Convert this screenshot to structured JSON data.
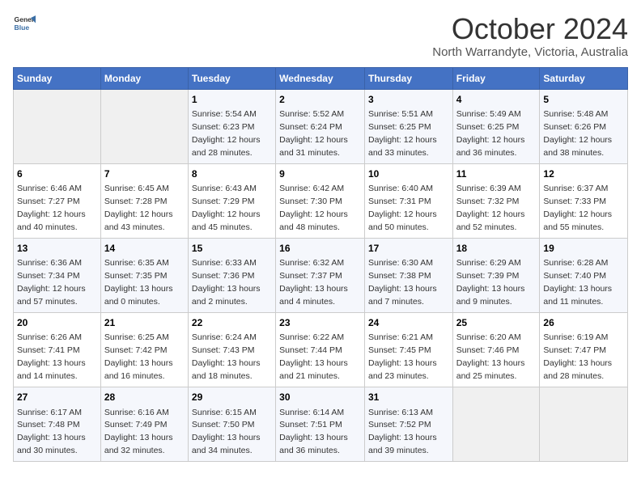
{
  "logo": {
    "general": "General",
    "blue": "Blue"
  },
  "title": "October 2024",
  "location": "North Warrandyte, Victoria, Australia",
  "headers": [
    "Sunday",
    "Monday",
    "Tuesday",
    "Wednesday",
    "Thursday",
    "Friday",
    "Saturday"
  ],
  "weeks": [
    [
      {
        "day": "",
        "info": ""
      },
      {
        "day": "",
        "info": ""
      },
      {
        "day": "1",
        "info": "Sunrise: 5:54 AM\nSunset: 6:23 PM\nDaylight: 12 hours and 28 minutes."
      },
      {
        "day": "2",
        "info": "Sunrise: 5:52 AM\nSunset: 6:24 PM\nDaylight: 12 hours and 31 minutes."
      },
      {
        "day": "3",
        "info": "Sunrise: 5:51 AM\nSunset: 6:25 PM\nDaylight: 12 hours and 33 minutes."
      },
      {
        "day": "4",
        "info": "Sunrise: 5:49 AM\nSunset: 6:25 PM\nDaylight: 12 hours and 36 minutes."
      },
      {
        "day": "5",
        "info": "Sunrise: 5:48 AM\nSunset: 6:26 PM\nDaylight: 12 hours and 38 minutes."
      }
    ],
    [
      {
        "day": "6",
        "info": "Sunrise: 6:46 AM\nSunset: 7:27 PM\nDaylight: 12 hours and 40 minutes."
      },
      {
        "day": "7",
        "info": "Sunrise: 6:45 AM\nSunset: 7:28 PM\nDaylight: 12 hours and 43 minutes."
      },
      {
        "day": "8",
        "info": "Sunrise: 6:43 AM\nSunset: 7:29 PM\nDaylight: 12 hours and 45 minutes."
      },
      {
        "day": "9",
        "info": "Sunrise: 6:42 AM\nSunset: 7:30 PM\nDaylight: 12 hours and 48 minutes."
      },
      {
        "day": "10",
        "info": "Sunrise: 6:40 AM\nSunset: 7:31 PM\nDaylight: 12 hours and 50 minutes."
      },
      {
        "day": "11",
        "info": "Sunrise: 6:39 AM\nSunset: 7:32 PM\nDaylight: 12 hours and 52 minutes."
      },
      {
        "day": "12",
        "info": "Sunrise: 6:37 AM\nSunset: 7:33 PM\nDaylight: 12 hours and 55 minutes."
      }
    ],
    [
      {
        "day": "13",
        "info": "Sunrise: 6:36 AM\nSunset: 7:34 PM\nDaylight: 12 hours and 57 minutes."
      },
      {
        "day": "14",
        "info": "Sunrise: 6:35 AM\nSunset: 7:35 PM\nDaylight: 13 hours and 0 minutes."
      },
      {
        "day": "15",
        "info": "Sunrise: 6:33 AM\nSunset: 7:36 PM\nDaylight: 13 hours and 2 minutes."
      },
      {
        "day": "16",
        "info": "Sunrise: 6:32 AM\nSunset: 7:37 PM\nDaylight: 13 hours and 4 minutes."
      },
      {
        "day": "17",
        "info": "Sunrise: 6:30 AM\nSunset: 7:38 PM\nDaylight: 13 hours and 7 minutes."
      },
      {
        "day": "18",
        "info": "Sunrise: 6:29 AM\nSunset: 7:39 PM\nDaylight: 13 hours and 9 minutes."
      },
      {
        "day": "19",
        "info": "Sunrise: 6:28 AM\nSunset: 7:40 PM\nDaylight: 13 hours and 11 minutes."
      }
    ],
    [
      {
        "day": "20",
        "info": "Sunrise: 6:26 AM\nSunset: 7:41 PM\nDaylight: 13 hours and 14 minutes."
      },
      {
        "day": "21",
        "info": "Sunrise: 6:25 AM\nSunset: 7:42 PM\nDaylight: 13 hours and 16 minutes."
      },
      {
        "day": "22",
        "info": "Sunrise: 6:24 AM\nSunset: 7:43 PM\nDaylight: 13 hours and 18 minutes."
      },
      {
        "day": "23",
        "info": "Sunrise: 6:22 AM\nSunset: 7:44 PM\nDaylight: 13 hours and 21 minutes."
      },
      {
        "day": "24",
        "info": "Sunrise: 6:21 AM\nSunset: 7:45 PM\nDaylight: 13 hours and 23 minutes."
      },
      {
        "day": "25",
        "info": "Sunrise: 6:20 AM\nSunset: 7:46 PM\nDaylight: 13 hours and 25 minutes."
      },
      {
        "day": "26",
        "info": "Sunrise: 6:19 AM\nSunset: 7:47 PM\nDaylight: 13 hours and 28 minutes."
      }
    ],
    [
      {
        "day": "27",
        "info": "Sunrise: 6:17 AM\nSunset: 7:48 PM\nDaylight: 13 hours and 30 minutes."
      },
      {
        "day": "28",
        "info": "Sunrise: 6:16 AM\nSunset: 7:49 PM\nDaylight: 13 hours and 32 minutes."
      },
      {
        "day": "29",
        "info": "Sunrise: 6:15 AM\nSunset: 7:50 PM\nDaylight: 13 hours and 34 minutes."
      },
      {
        "day": "30",
        "info": "Sunrise: 6:14 AM\nSunset: 7:51 PM\nDaylight: 13 hours and 36 minutes."
      },
      {
        "day": "31",
        "info": "Sunrise: 6:13 AM\nSunset: 7:52 PM\nDaylight: 13 hours and 39 minutes."
      },
      {
        "day": "",
        "info": ""
      },
      {
        "day": "",
        "info": ""
      }
    ]
  ]
}
